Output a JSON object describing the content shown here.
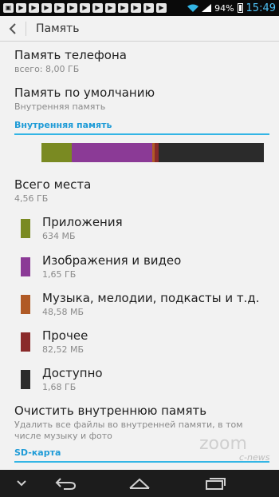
{
  "status_bar": {
    "battery_percent": "94%",
    "time": "15:49",
    "notification_icons": [
      "photo-icon",
      "play-icon",
      "play-icon",
      "play-icon",
      "play-icon",
      "play-icon",
      "play-icon",
      "play-icon",
      "play-icon",
      "play-icon",
      "play-icon",
      "play-icon",
      "play-icon"
    ]
  },
  "action_bar": {
    "title": "Память"
  },
  "phone_storage": {
    "title": "Память телефона",
    "subtitle": "всего: 8,00  ГБ"
  },
  "default_storage": {
    "title": "Память по умолчанию",
    "subtitle": "Внутренняя память"
  },
  "internal_section": {
    "header": "Внутренняя память"
  },
  "usage_bar": {
    "segments": [
      {
        "name": "apps",
        "fraction": 0.136,
        "color": "#7a8a22"
      },
      {
        "name": "media",
        "fraction": 0.362,
        "color": "#8b3a96"
      },
      {
        "name": "audio",
        "fraction": 0.011,
        "color": "#b05a26"
      },
      {
        "name": "other",
        "fraction": 0.018,
        "color": "#8a2a2a"
      },
      {
        "name": "available",
        "fraction": 0.473,
        "color": "#2b2b2b"
      }
    ]
  },
  "total": {
    "title": "Всего места",
    "subtitle": "4,56 ГБ"
  },
  "items": [
    {
      "label": "Приложения",
      "value": "634 МБ",
      "color": "#7a8a22"
    },
    {
      "label": "Изображения и видео",
      "value": "1,65 ГБ",
      "color": "#8b3a96"
    },
    {
      "label": "Музыка, мелодии, подкасты и т.д.",
      "value": "48,58 МБ",
      "color": "#b05a26"
    },
    {
      "label": "Прочее",
      "value": "82,52 МБ",
      "color": "#8a2a2a"
    },
    {
      "label": "Доступно",
      "value": "1,68 ГБ",
      "color": "#2b2b2b"
    }
  ],
  "clear": {
    "title": "Очистить внутреннюю память",
    "desc_line1": "Удалить все файлы во внутренней памяти, в том",
    "desc_line2": "числе музыку и фото"
  },
  "sd_section": {
    "header": "SD-карта"
  },
  "watermark": {
    "main": "zoom",
    "sub": "c-news"
  },
  "colors": {
    "accent": "#33b5e5",
    "background": "#f2f2f2"
  }
}
